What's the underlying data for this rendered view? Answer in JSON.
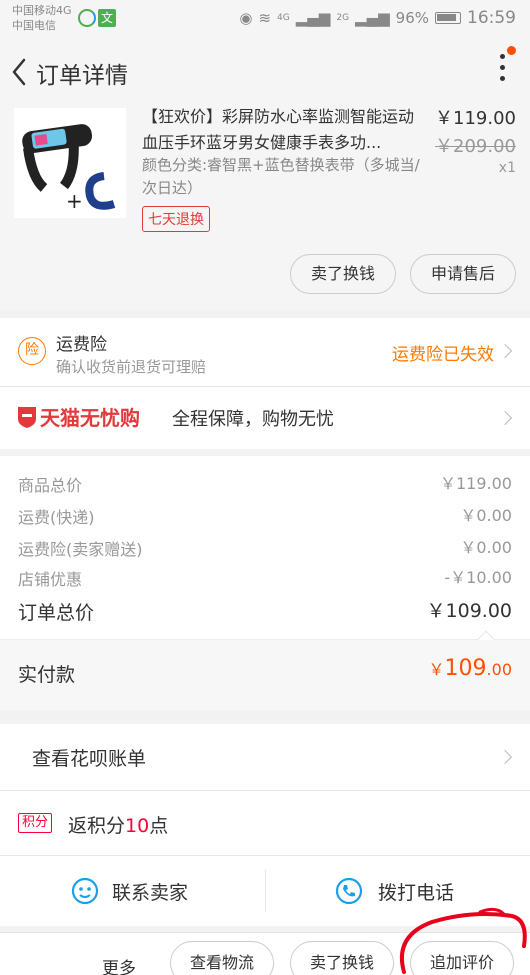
{
  "status_bar": {
    "carrier1": "中国移动4G",
    "carrier2": "中国电信",
    "net1": "4G",
    "net2": "2G",
    "battery": "96%",
    "time": "16:59"
  },
  "header": {
    "title": "订单详情"
  },
  "product": {
    "name": "【狂欢价】彩屏防水心率监测智能运动血压手环蓝牙男女健康手表多功...",
    "spec": "颜色分类:睿智黑+蓝色替换表带（多城当/次日达）",
    "price": "￥119.00",
    "original_price": "￥209.00",
    "quantity": "x1",
    "return_tag": "七天退换",
    "actions": [
      "卖了换钱",
      "申请售后"
    ]
  },
  "insurance": {
    "icon_char": "险",
    "title": "运费险",
    "subtitle": "确认收货前退货可理赔",
    "status": "运费险已失效"
  },
  "tmall": {
    "brand": "天猫无忧购",
    "slogan": "全程保障，购物无忧"
  },
  "costs": {
    "rows": [
      {
        "label": "商品总价",
        "value": "￥119.00"
      },
      {
        "label": "运费(快递)",
        "value": "￥0.00"
      },
      {
        "label": "运费险(卖家赠送)",
        "value": "￥0.00"
      },
      {
        "label": "店铺优惠",
        "value": "-￥10.00"
      }
    ],
    "total_label": "订单总价",
    "total_value": "￥109.00",
    "paid_label": "实付款",
    "paid_currency": "￥",
    "paid_int": "109",
    "paid_dec": ".00"
  },
  "huabei": {
    "label": "查看花呗账单"
  },
  "points": {
    "tag": "积分",
    "prefix": "返积分",
    "amount": "10",
    "suffix": "点"
  },
  "contact": {
    "seller": "联系卖家",
    "phone": "拨打电话"
  },
  "bottom_bar": {
    "more": "更多",
    "buttons": [
      "查看物流",
      "卖了换钱",
      "追加评价"
    ]
  },
  "colors": {
    "accent": "#ff5000",
    "insurance": "#ff7a00",
    "tmall_red": "#e4393c",
    "points": "#ff0036"
  }
}
